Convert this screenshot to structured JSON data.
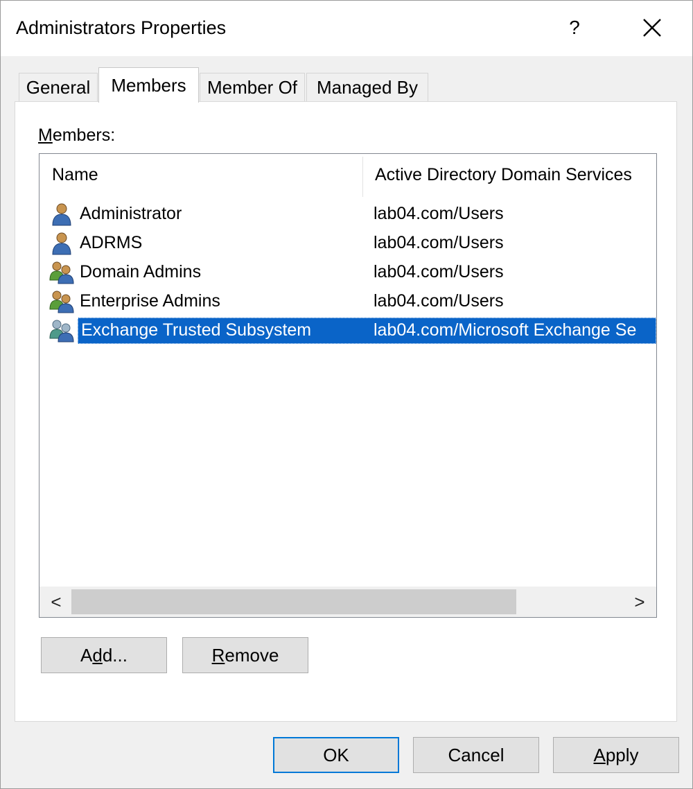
{
  "window": {
    "title": "Administrators Properties",
    "help_label": "?"
  },
  "tabs": [
    {
      "label": "General"
    },
    {
      "label": "Members"
    },
    {
      "label": "Member Of"
    },
    {
      "label": "Managed By"
    }
  ],
  "members": {
    "label_first": "M",
    "label_rest": "embers:",
    "columns": [
      "Name",
      "Active Directory Domain Services"
    ],
    "rows": [
      {
        "name": "Administrator",
        "folder": "lab04.com/Users",
        "icon": "user-icon"
      },
      {
        "name": "ADRMS",
        "folder": "lab04.com/Users",
        "icon": "user-icon"
      },
      {
        "name": "Domain Admins",
        "folder": "lab04.com/Users",
        "icon": "group-icon"
      },
      {
        "name": "Enterprise Admins",
        "folder": "lab04.com/Users",
        "icon": "group-icon"
      },
      {
        "name": "Exchange Trusted Subsystem",
        "folder": "lab04.com/Microsoft Exchange Se",
        "icon": "group-icon",
        "selected": true
      }
    ],
    "scroll_left": "<",
    "scroll_right": ">"
  },
  "buttons": {
    "add_pre": "A",
    "add_ul": "d",
    "add_post": "d...",
    "remove_ul": "R",
    "remove_post": "emove",
    "ok": "OK",
    "cancel": "Cancel",
    "apply_ul": "A",
    "apply_post": "pply"
  },
  "colors": {
    "selection": "#0a64c8",
    "default_button_border": "#0078d7"
  }
}
